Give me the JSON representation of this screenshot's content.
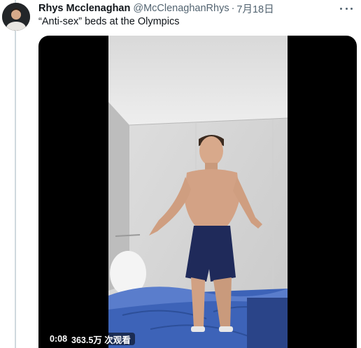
{
  "tweet": {
    "display_name": "Rhys Mcclenaghan",
    "handle": "@McClenaghanRhys",
    "separator": "·",
    "date": "7月18日",
    "text": "“Anti-sex” beds at the Olympics"
  },
  "video": {
    "time": "0:08",
    "views": "363.5万 次观看"
  },
  "colors": {
    "text_primary": "#0f1419",
    "text_secondary": "#536471",
    "thread_line": "#cfd9de",
    "duvet_blue": "#3d63b8"
  },
  "icons": {
    "more": "more-horizontal-icon"
  }
}
